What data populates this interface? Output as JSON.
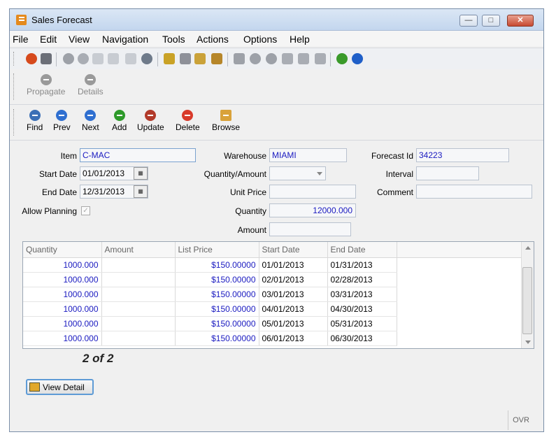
{
  "window": {
    "title": "Sales Forecast"
  },
  "menu": [
    "File",
    "Edit",
    "View",
    "Navigation",
    "Tools",
    "Actions",
    "Options",
    "Help"
  ],
  "toolbar2": {
    "propagate": "Propagate",
    "details": "Details"
  },
  "toolbar3": {
    "find": "Find",
    "prev": "Prev",
    "next": "Next",
    "add": "Add",
    "update": "Update",
    "delete": "Delete",
    "browse": "Browse"
  },
  "form": {
    "item_label": "Item",
    "item_value": "C-MAC",
    "warehouse_label": "Warehouse",
    "warehouse_value": "MIAMI",
    "forecast_id_label": "Forecast Id",
    "forecast_id_value": "34223",
    "start_date_label": "Start Date",
    "start_date_value": "01/01/2013",
    "qty_amount_label": "Quantity/Amount",
    "qty_amount_value": "",
    "interval_label": "Interval",
    "interval_value": "",
    "end_date_label": "End Date",
    "end_date_value": "12/31/2013",
    "unit_price_label": "Unit Price",
    "unit_price_value": "",
    "comment_label": "Comment",
    "comment_value": "",
    "allow_planning_label": "Allow Planning",
    "allow_planning_checked": true,
    "quantity_label": "Quantity",
    "quantity_value": "12000.000",
    "amount_label": "Amount",
    "amount_value": ""
  },
  "grid": {
    "columns": [
      "Quantity",
      "Amount",
      "List Price",
      "Start Date",
      "End Date"
    ],
    "rows": [
      {
        "quantity": "1000.000",
        "amount": "",
        "list_price": "$150.00000",
        "start": "01/01/2013",
        "end": "01/31/2013"
      },
      {
        "quantity": "1000.000",
        "amount": "",
        "list_price": "$150.00000",
        "start": "02/01/2013",
        "end": "02/28/2013"
      },
      {
        "quantity": "1000.000",
        "amount": "",
        "list_price": "$150.00000",
        "start": "03/01/2013",
        "end": "03/31/2013"
      },
      {
        "quantity": "1000.000",
        "amount": "",
        "list_price": "$150.00000",
        "start": "04/01/2013",
        "end": "04/30/2013"
      },
      {
        "quantity": "1000.000",
        "amount": "",
        "list_price": "$150.00000",
        "start": "05/01/2013",
        "end": "05/31/2013"
      },
      {
        "quantity": "1000.000",
        "amount": "",
        "list_price": "$150.00000",
        "start": "06/01/2013",
        "end": "06/30/2013"
      }
    ]
  },
  "pager": "2 of 2",
  "view_detail": "View Detail",
  "status": {
    "ovr": "OVR"
  },
  "colors": {
    "accent_blue": "#1a1ac0",
    "focus_border": "#5e9bd6"
  }
}
